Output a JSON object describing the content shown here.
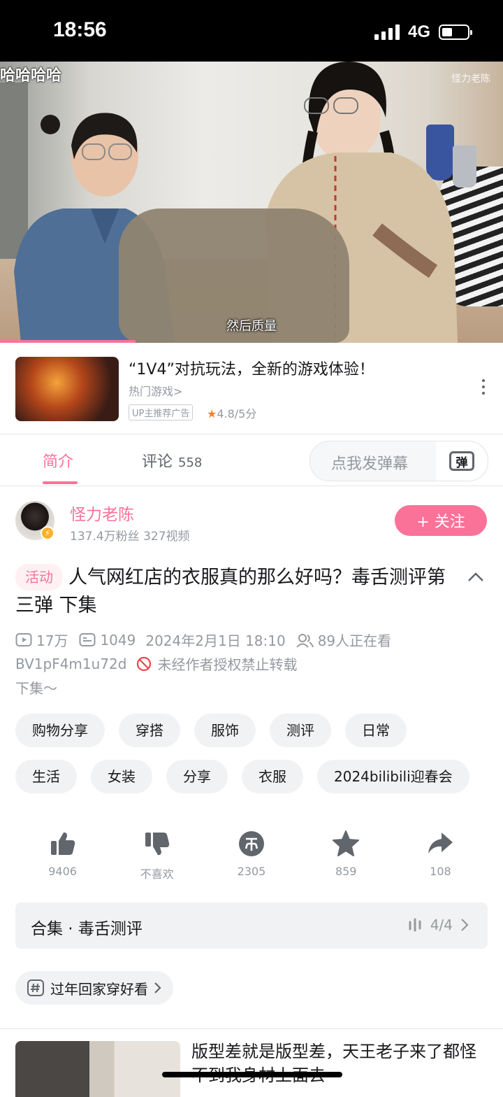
{
  "status_bar": {
    "time": "18:56",
    "network": "4G"
  },
  "video": {
    "danmaku": "哈哈哈哈",
    "watermark": "怪力老陈",
    "subtitle": "然后质量",
    "progress_fraction": 0.27
  },
  "ad": {
    "title": "“1V4”对抗玩法，全新的游戏体验！",
    "category": "热门游戏>",
    "badge": "UP主推荐广告",
    "rating": "4.8/5分"
  },
  "tabs": {
    "intro": "简介",
    "comments": "评论",
    "comment_count": "558",
    "danmaku_placeholder": "点我发弹幕",
    "danmaku_icon_text": "弹"
  },
  "uploader": {
    "name": "怪力老陈",
    "stats": "137.4万粉丝  327视频",
    "follow_label": "+ 关注"
  },
  "video_info": {
    "activity_tag": "活动",
    "title": "人气网红店的衣服真的那么好吗？毒舌测评第三弹 下集",
    "views": "17万",
    "danmaku_count": "1049",
    "date": "2024年2月1日 18:10",
    "watching": "89人正在看",
    "bvid": "BV1pF4m1u72d",
    "no_repost": "未经作者授权禁止转载",
    "description": "下集～"
  },
  "tags_row1": [
    "购物分享",
    "穿搭",
    "服饰",
    "测评",
    "日常"
  ],
  "tags_row2": [
    "生活",
    "女装",
    "分享",
    "衣服",
    "2024bilibili迎春会"
  ],
  "actions": [
    {
      "icon": "thumb-up-icon",
      "label": "9406"
    },
    {
      "icon": "thumb-down-icon",
      "label": "不喜欢"
    },
    {
      "icon": "coin-icon",
      "label": "2305"
    },
    {
      "icon": "star-icon",
      "label": "859"
    },
    {
      "icon": "share-icon",
      "label": "108"
    }
  ],
  "collection": {
    "title": "合集 · 毒舌测评",
    "progress": "4/4"
  },
  "topic": {
    "label": "过年回家穿好看"
  },
  "recommendation": {
    "title": "版型差就是版型差，天王老子来了都怪不到我身材上面去"
  },
  "colors": {
    "accent": "#fb7299",
    "gray": "#9499a0",
    "rating_star": "#ff7f24"
  }
}
